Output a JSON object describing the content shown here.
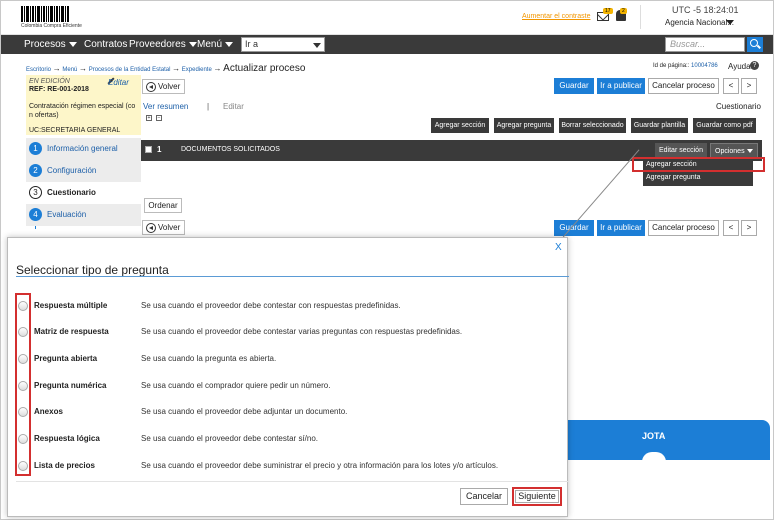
{
  "header": {
    "logo_caption": "Colombia Compra Eficiente",
    "change_password": "Aumentar el contraste",
    "mail_badge": "17",
    "notif_badge": "2",
    "utc": "UTC -5 18:24:01",
    "agency": "Agencia Nacional..."
  },
  "nav": {
    "items": [
      "Procesos",
      "Contratos",
      "Proveedores",
      "Menú"
    ],
    "go_to": "Ir a",
    "search_placeholder": "Buscar..."
  },
  "breadcrumb": {
    "items": [
      "Escritorio",
      "Menú",
      "Procesos de la Entidad Estatal",
      "Expediente"
    ],
    "current": "Actualizar proceso",
    "page_id_label": "Id de página::",
    "page_id_value": "10004786",
    "help": "Ayuda"
  },
  "left_panel": {
    "status": "EN EDICIÓN",
    "edit": "Editar",
    "ref": "REF: RE-001-2018",
    "type": "Contratación régimen especial (co n ofertas)",
    "uc": "UC:SECRETARIA GENERAL"
  },
  "steps": [
    {
      "num": "1",
      "label": "Información general"
    },
    {
      "num": "2",
      "label": "Configuración"
    },
    {
      "num": "3",
      "label": "Cuestionario"
    },
    {
      "num": "4",
      "label": "Evaluación"
    }
  ],
  "toolbar": {
    "back": "Volver",
    "save": "Guardar",
    "publish": "Ir a publicar",
    "cancel": "Cancelar proceso",
    "prev": "<",
    "next": ">"
  },
  "tabs": {
    "summary": "Ver resumen",
    "separator": "|",
    "edit": "Editar",
    "questionnaire": "Cuestionario"
  },
  "actions": {
    "add_section": "Agregar sección",
    "add_question": "Agregar pregunta",
    "delete_selected": "Borrar seleccionado",
    "save_template": "Guardar plantilla",
    "save_pdf": "Guardar como pdf"
  },
  "section": {
    "number": "1",
    "title": "DOCUMENTOS SOLICITADOS",
    "edit": "Editar sección",
    "options": "Opciones"
  },
  "dropdown": {
    "items": [
      "Agregar sección",
      "Agregar pregunta"
    ]
  },
  "order_button": "Ordenar",
  "banner": {
    "text": "JOTA"
  },
  "modal": {
    "close": "X",
    "title": "Seleccionar tipo de pregunta",
    "options": [
      {
        "name": "Respuesta múltiple",
        "desc": "Se usa cuando el proveedor debe contestar con respuestas predefinidas."
      },
      {
        "name": "Matriz de respuesta",
        "desc": "Se usa cuando el proveedor debe contestar varias preguntas con respuestas predefinidas."
      },
      {
        "name": "Pregunta abierta",
        "desc": "Se usa cuando la pregunta es abierta."
      },
      {
        "name": "Pregunta numérica",
        "desc": "Se usa cuando el comprador quiere pedir un número."
      },
      {
        "name": "Anexos",
        "desc": "Se usa cuando el proveedor debe adjuntar un documento."
      },
      {
        "name": "Respuesta lógica",
        "desc": "Se usa cuando el proveedor debe contestar sí/no."
      },
      {
        "name": "Lista de precios",
        "desc": "Se usa cuando el proveedor debe suministrar el precio y otra información para los lotes y/o artículos."
      }
    ],
    "cancel": "Cancelar",
    "next": "Siguiente"
  },
  "colors": {
    "primary": "#1c7ed6",
    "dark": "#3a3a3a",
    "highlight": "#d32f2f",
    "panel": "#fdf6c9"
  }
}
